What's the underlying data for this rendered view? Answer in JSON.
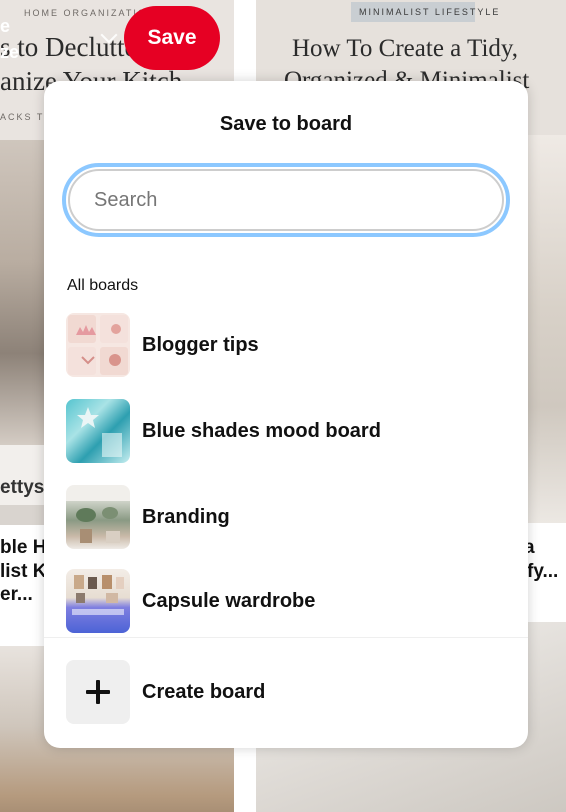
{
  "background": {
    "left_pin": {
      "tag": "HOME ORGANIZATION",
      "title_line1": "s to Declutter and",
      "title_line2": "anize Your Kitch",
      "subtext": "ACKS TO",
      "side_text_1": "e",
      "side_text_2": "ze",
      "caption_fragment": "ettys",
      "description_line1": "ble Ha",
      "description_line2": "list K",
      "description_line3": "er..."
    },
    "right_pin": {
      "tag": "MINIMALIST LIFESTYLE",
      "title_line1": "How To Create a Tidy,",
      "title_line2": "Organized & Minimalist",
      "description_line1": "a",
      "description_line2": "fy..."
    }
  },
  "save_button": {
    "label": "Save",
    "color": "#e60023"
  },
  "popup": {
    "title": "Save to board",
    "search": {
      "placeholder": "Search",
      "value": ""
    },
    "section_label": "All boards",
    "boards": [
      {
        "name": "Blogger tips",
        "thumb_icon": "canva-mailchimp-collage"
      },
      {
        "name": "Blue shades mood board",
        "thumb_icon": "blue-ocean-collage"
      },
      {
        "name": "Branding",
        "thumb_icon": "plants-interior-collage"
      },
      {
        "name": "Capsule wardrobe",
        "thumb_icon": "wardrobe-collage"
      }
    ],
    "create": {
      "label": "Create board",
      "icon": "plus-icon"
    }
  }
}
